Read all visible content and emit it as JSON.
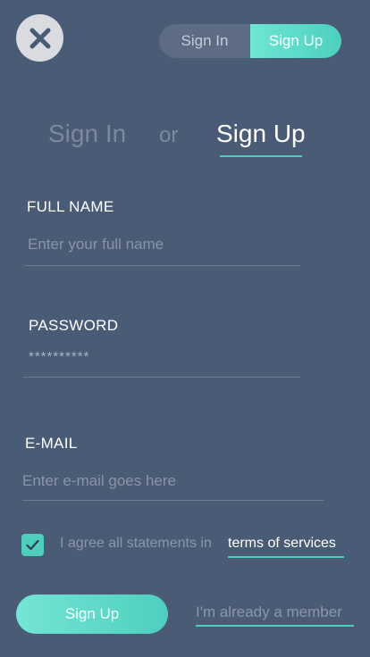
{
  "close": {
    "icon": "close-icon"
  },
  "toggle": {
    "signin_label": "Sign In",
    "signup_label": "Sign Up"
  },
  "heading": {
    "signin": "Sign In",
    "or": "or",
    "signup": "Sign Up"
  },
  "form": {
    "full_name": {
      "label": "FULL NAME",
      "placeholder": "Enter your full name",
      "value": ""
    },
    "password": {
      "label": "PASSWORD",
      "value": "**********"
    },
    "email": {
      "label": "E-MAIL",
      "placeholder": "Enter e-mail goes here",
      "value": ""
    }
  },
  "agree": {
    "checked": true,
    "text": "I agree all statements in",
    "link": "terms of services"
  },
  "actions": {
    "submit_label": "Sign Up",
    "member_link": "I'm already a member"
  },
  "colors": {
    "background": "#4a5b76",
    "accent": "#4ecfbe"
  }
}
